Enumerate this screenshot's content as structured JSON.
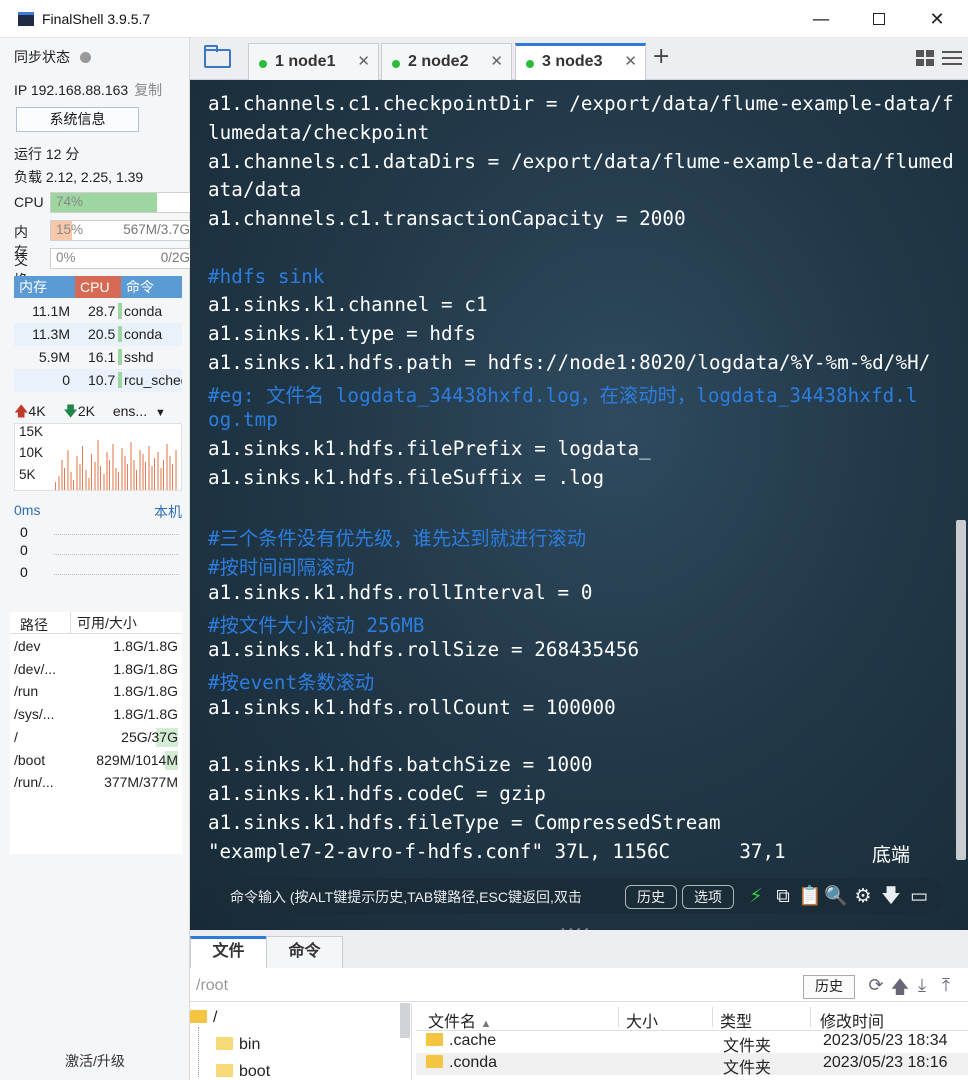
{
  "window": {
    "title": "FinalShell 3.9.5.7",
    "minimize": "—",
    "close": "✕"
  },
  "left": {
    "sync_label": "同步状态",
    "ip_label": "IP 192.168.88.163",
    "copy_label": "复制",
    "sysinfo_button": "系统信息",
    "uptime": "运行 12 分",
    "load": "负载 2.12, 2.25, 1.39",
    "cpu": {
      "label": "CPU",
      "percent": 74,
      "text": "74%",
      "color": "#9dd6a0"
    },
    "mem": {
      "label": "内存",
      "percent": 15,
      "text": "15%",
      "detail": "567M/3.7G",
      "color": "#f6c7a8"
    },
    "swap": {
      "label": "交换",
      "percent": 0,
      "text": "0%",
      "detail": "0/2G"
    },
    "proc_headers": {
      "mem": "内存",
      "cpu": "CPU",
      "cmd": "命令"
    },
    "processes": [
      {
        "mem": "11.1M",
        "cpu": "28.7",
        "cmd": "conda"
      },
      {
        "mem": "11.3M",
        "cpu": "20.5",
        "cmd": "conda"
      },
      {
        "mem": "5.9M",
        "cpu": "16.1",
        "cmd": "sshd"
      },
      {
        "mem": "0",
        "cpu": "10.7",
        "cmd": "rcu_sched"
      }
    ],
    "net": {
      "up": "4K",
      "down": "2K",
      "iface": "ens...",
      "ticks": [
        "15K",
        "10K",
        "5K"
      ]
    },
    "latency": {
      "ms": "0ms",
      "host": "本机",
      "values": [
        "0",
        "0",
        "0"
      ]
    },
    "disk_headers": {
      "path": "路径",
      "size": "可用/大小"
    },
    "disks": [
      {
        "path": "/dev",
        "size": "1.8G/1.8G",
        "used": 0
      },
      {
        "path": "/dev/...",
        "size": "1.8G/1.8G",
        "used": 0
      },
      {
        "path": "/run",
        "size": "1.8G/1.8G",
        "used": 0
      },
      {
        "path": "/sys/...",
        "size": "1.8G/1.8G",
        "used": 0
      },
      {
        "path": "/",
        "size": "25G/37G",
        "used": 0.32
      },
      {
        "path": "/boot",
        "size": "829M/1014M",
        "used": 0.18
      },
      {
        "path": "/run/...",
        "size": "377M/377M",
        "used": 0
      }
    ],
    "activate": "激活/升级"
  },
  "tabs": [
    {
      "label": "1 node1",
      "close": "✕"
    },
    {
      "label": "2 node2",
      "close": "✕"
    },
    {
      "label": "3 node3",
      "close": "✕"
    }
  ],
  "tab_add": "+",
  "terminal": {
    "lines": [
      {
        "text": "a1.channels.c1.checkpointDir = /export/data/flume-example-data/f",
        "comment": false
      },
      {
        "text": "lumedata/checkpoint",
        "comment": false
      },
      {
        "text": "a1.channels.c1.dataDirs = /export/data/flume-example-data/flumed",
        "comment": false
      },
      {
        "text": "ata/data",
        "comment": false
      },
      {
        "text": "a1.channels.c1.transactionCapacity = 2000",
        "comment": false
      },
      {
        "text": "",
        "comment": false
      },
      {
        "text": "#hdfs sink",
        "comment": true
      },
      {
        "text": "a1.sinks.k1.channel = c1",
        "comment": false
      },
      {
        "text": "a1.sinks.k1.type = hdfs",
        "comment": false
      },
      {
        "text": "a1.sinks.k1.hdfs.path = hdfs://node1:8020/logdata/%Y-%m-%d/%H/",
        "comment": false
      },
      {
        "text": "#eg: 文件名 logdata_34438hxfd.log，在滚动时，logdata_34438hxfd.l",
        "comment": true
      },
      {
        "text": "og.tmp",
        "comment": true
      },
      {
        "text": "a1.sinks.k1.hdfs.filePrefix = logdata_",
        "comment": false
      },
      {
        "text": "a1.sinks.k1.hdfs.fileSuffix = .log",
        "comment": false
      },
      {
        "text": "",
        "comment": false
      },
      {
        "text": "#三个条件没有优先级，谁先达到就进行滚动",
        "comment": true
      },
      {
        "text": "#按时间间隔滚动",
        "comment": true
      },
      {
        "text": "a1.sinks.k1.hdfs.rollInterval = 0",
        "comment": false
      },
      {
        "text": "#按文件大小滚动 256MB",
        "comment": true
      },
      {
        "text": "a1.sinks.k1.hdfs.rollSize = 268435456",
        "comment": false
      },
      {
        "text": "#按event条数滚动",
        "comment": true
      },
      {
        "text": "a1.sinks.k1.hdfs.rollCount = 100000",
        "comment": false
      },
      {
        "text": "",
        "comment": false
      },
      {
        "text": "a1.sinks.k1.hdfs.batchSize = 1000",
        "comment": false
      },
      {
        "text": "a1.sinks.k1.hdfs.codeC = gzip",
        "comment": false
      },
      {
        "text": "a1.sinks.k1.hdfs.fileType = CompressedStream",
        "comment": false
      }
    ],
    "status_left": "\"example7-2-avro-f-hdfs.conf\" 37L, 1156C      37,1",
    "status_right": "底端",
    "cmd_placeholder": "命令输入 (按ALT键提示历史,TAB键路径,ESC键返回,双击",
    "history_btn": "历史",
    "options_btn": "选项"
  },
  "bottom": {
    "tab_files": "文件",
    "tab_commands": "命令",
    "path": "/root",
    "history_btn": "历史",
    "tree": {
      "root": "/",
      "bin": "bin",
      "boot": "boot"
    },
    "file_headers": {
      "name": "文件名",
      "size": "大小",
      "type": "类型",
      "mtime": "修改时间"
    },
    "files": [
      {
        "name": ".cache",
        "size": "",
        "type": "文件夹",
        "mtime": "2023/05/23 18:34"
      },
      {
        "name": ".conda",
        "size": "",
        "type": "文件夹",
        "mtime": "2023/05/23 18:16"
      }
    ]
  }
}
